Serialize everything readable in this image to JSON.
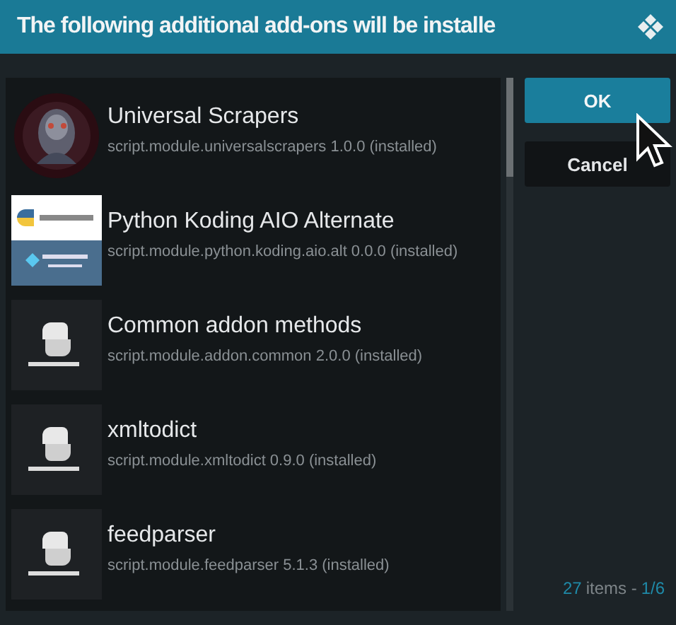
{
  "window": {
    "title": "The following additional add-ons will be installe"
  },
  "addons": [
    {
      "name": "Universal Scrapers",
      "detail": "script.module.universalscrapers 1.0.0 (installed)",
      "kind": "picture"
    },
    {
      "name": "Python Koding AIO Alternate",
      "detail": "script.module.python.koding.aio.alt 0.0.0 (installed)",
      "kind": "combo"
    },
    {
      "name": "Common addon methods",
      "detail": "script.module.addon.common 2.0.0 (installed)",
      "kind": "python"
    },
    {
      "name": "xmltodict",
      "detail": "script.module.xmltodict 0.9.0 (installed)",
      "kind": "python"
    },
    {
      "name": "feedparser",
      "detail": "script.module.feedparser 5.1.3 (installed)",
      "kind": "python"
    }
  ],
  "buttons": [
    {
      "label": "OK",
      "selected": true
    },
    {
      "label": "Cancel",
      "selected": false
    }
  ],
  "footer": {
    "count": "27",
    "unit": "items -",
    "page": "1/6"
  }
}
